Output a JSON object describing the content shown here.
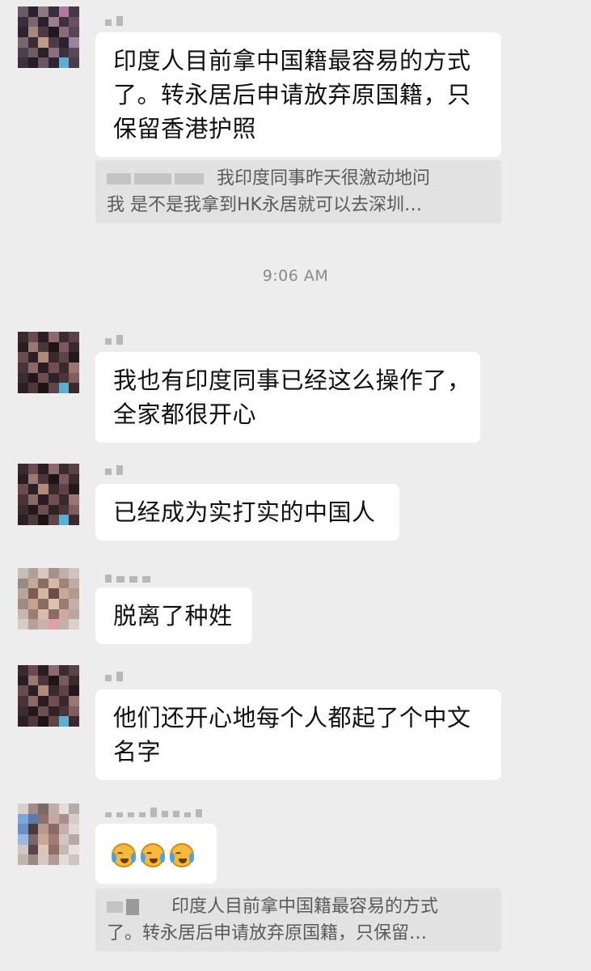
{
  "timestamp": "9:06 AM",
  "messages": [
    {
      "lines": [
        "印度人目前拿中国籍最容易的方式",
        "了。转永居后申请放弃原国籍，只",
        "保留香港护照"
      ],
      "quote": [
        "我印度同事昨天很激动地问",
        "我 是不是我拿到HK永居就可以去深圳…"
      ]
    },
    {
      "lines": [
        "我也有印度同事已经这么操作了，",
        "全家都很开心"
      ]
    },
    {
      "lines": [
        "已经成为实打实的中国人"
      ]
    },
    {
      "lines": [
        "脱离了种姓"
      ]
    },
    {
      "lines": [
        "他们还开心地每个人都起了个中文",
        "名字"
      ]
    },
    {
      "emojis": [
        "crying-laughing-emoji",
        "crying-laughing-emoji",
        "crying-laughing-emoji"
      ],
      "quote": [
        "印度人目前拿中国籍最容易的方式",
        "了。转永居后申请放弃原国籍，只保留…"
      ]
    }
  ]
}
